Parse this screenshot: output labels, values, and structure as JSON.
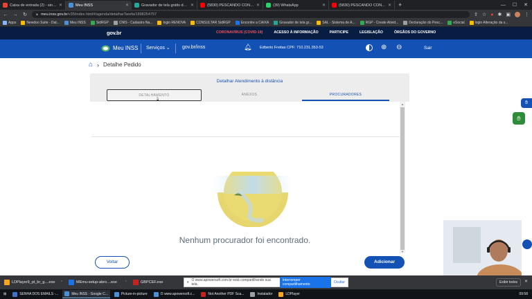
{
  "browser": {
    "tabs": [
      {
        "title": "Caixa de entrada (2) - sindicato...",
        "color": "#ea4335",
        "active": false
      },
      {
        "title": "Meu INSS",
        "color": "#4a90d9",
        "active": true
      },
      {
        "title": "Gravador de tela grátis da A...",
        "color": "#26a69a",
        "active": false
      },
      {
        "title": "(5830) PESCANDO CONHECIME...",
        "color": "#ff0000",
        "active": false
      },
      {
        "title": "(39) WhatsApp",
        "color": "#25d366",
        "active": false
      },
      {
        "title": "(5830) PESCANDO CONHECIME...",
        "color": "#ff0000",
        "active": false
      }
    ],
    "new_tab": "+",
    "url_host": "meu.inss.gov.br",
    "url_path": "/v35/index.html#/agenda/detalharTarefa/1898254757",
    "bookmarks": [
      {
        "label": "Apps",
        "color": "#8ab4f8"
      },
      {
        "label": "Newdoo Suite - Dat...",
        "color": "#fbbc04"
      },
      {
        "label": "Meu INSS",
        "color": "#4a90d9"
      },
      {
        "label": "SidRGP",
        "color": "#34a853"
      },
      {
        "label": "CNIS - Cadastro Na...",
        "color": "#9aa0a6"
      },
      {
        "label": "login RENOVA",
        "color": "#fbbc04"
      },
      {
        "label": "CONSULTAR SidRGP",
        "color": "#fbbc04"
      },
      {
        "label": "Encontre a CAIXA",
        "color": "#1a73e8"
      },
      {
        "label": "Gravador de tela gr...",
        "color": "#26a69a"
      },
      {
        "label": "SAL - Sistema de A...",
        "color": "#fbbc04"
      },
      {
        "label": "RGP - Create Ativid...",
        "color": "#34a853"
      },
      {
        "label": "Declaração do Pesc...",
        "color": "#9aa0a6"
      },
      {
        "label": "eSocial",
        "color": "#34a853"
      },
      {
        "label": "login Alteração da s...",
        "color": "#fbbc04"
      }
    ]
  },
  "gov": {
    "logo": "gov.br",
    "links": [
      "CORONAVÍRUS (COVID-19)",
      "ACESSO À INFORMAÇÃO",
      "PARTICIPE",
      "LEGISLAÇÃO",
      "ÓRGÃOS DO GOVERNO"
    ]
  },
  "inss": {
    "name": "Meu INSS",
    "servicos": "Serviços ⌄",
    "govinss": "gov.br/inss",
    "user": "Edberto Freitas  CPF: 710.231.353-53",
    "sair": "Sair"
  },
  "breadcrumb": {
    "title": "Detalhe Pedido"
  },
  "card": {
    "title": "Detalhar Atendimento à distância",
    "tabs": [
      "DETALHAMENTO",
      "ANEXOS",
      "PROCURADORES"
    ],
    "active_tab": "PROCURADORES",
    "empty_message": "Nenhum procurador foi encontrado."
  },
  "actions": {
    "back": "Voltar",
    "add": "Adicionar"
  },
  "downloads": {
    "items": [
      {
        "name": "LDPlayer9_pt_br_g....exe",
        "color": "#f5a623"
      },
      {
        "name": "MEmu-setup-abro....exe",
        "color": "#1a73e8"
      },
      {
        "name": "GBPCEF.exe",
        "color": "#c5221f"
      }
    ],
    "share_text": "O www.apowersoft.com.br está compartilhando sua tela.",
    "share_stop": "Interromper compartilhamento",
    "share_hide": "Ocultar",
    "show_all": "Exibir todos"
  },
  "taskbar": {
    "items": [
      {
        "label": "SENHA DOS EMAILS -...",
        "color": "#4472c4",
        "active": false
      },
      {
        "label": "Meu INSS - Google C...",
        "color": "#4a90d9",
        "active": true
      },
      {
        "label": "Picture-in-picture",
        "color": "#4a90d9",
        "active": false
      },
      {
        "label": "O www.apowersoft.c...",
        "color": "#4a90d9",
        "active": false
      },
      {
        "label": "Not Another PDF Sca...",
        "color": "#c5221f",
        "active": false
      },
      {
        "label": "Instalador",
        "color": "#9aa0a6",
        "active": false
      },
      {
        "label": "LDPlayer",
        "color": "#f5a623",
        "active": false
      }
    ],
    "clock": "09:58"
  }
}
